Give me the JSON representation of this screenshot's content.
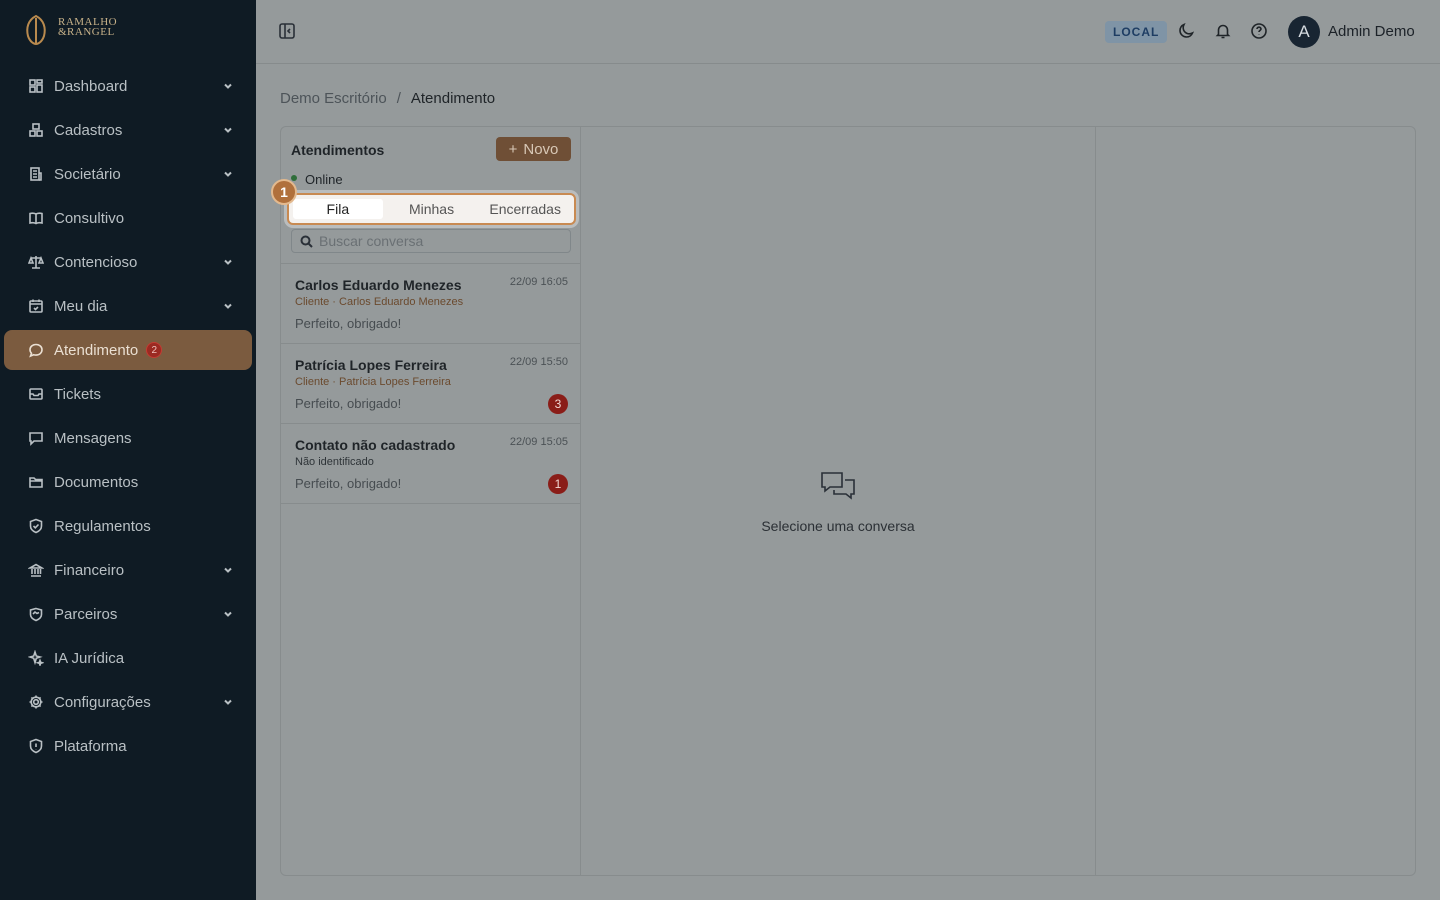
{
  "brand": {
    "line1": "RAMALHO",
    "line2": "&RANGEL"
  },
  "sidebar": {
    "items": [
      {
        "label": "Dashboard",
        "icon": "dashboard-icon",
        "chevron": true
      },
      {
        "label": "Cadastros",
        "icon": "boxes-icon",
        "chevron": true
      },
      {
        "label": "Societário",
        "icon": "building-icon",
        "chevron": true
      },
      {
        "label": "Consultivo",
        "icon": "book-icon",
        "chevron": false
      },
      {
        "label": "Contencioso",
        "icon": "scale-icon",
        "chevron": true
      },
      {
        "label": "Meu dia",
        "icon": "calendar-icon",
        "chevron": true
      },
      {
        "label": "Atendimento",
        "icon": "chat-icon",
        "chevron": false,
        "badge": "2",
        "active": true
      },
      {
        "label": "Tickets",
        "icon": "ticket-icon",
        "chevron": false
      },
      {
        "label": "Mensagens",
        "icon": "message-icon",
        "chevron": false
      },
      {
        "label": "Documentos",
        "icon": "folder-icon",
        "chevron": false
      },
      {
        "label": "Regulamentos",
        "icon": "shield-check-icon",
        "chevron": false
      },
      {
        "label": "Financeiro",
        "icon": "bank-icon",
        "chevron": true
      },
      {
        "label": "Parceiros",
        "icon": "handshake-icon",
        "chevron": true
      },
      {
        "label": "IA Jurídica",
        "icon": "sparkles-icon",
        "chevron": false
      },
      {
        "label": "Configurações",
        "icon": "gear-icon",
        "chevron": true
      },
      {
        "label": "Plataforma",
        "icon": "shield-icon",
        "chevron": false
      }
    ]
  },
  "topbar": {
    "env_badge": "LOCAL",
    "avatar_initial": "A",
    "user_name": "Admin Demo"
  },
  "breadcrumb": {
    "parent": "Demo Escritório",
    "separator": "/",
    "current": "Atendimento"
  },
  "list": {
    "title": "Atendimentos",
    "new_button": "Novo",
    "status": "Online",
    "step_marker": "1",
    "tabs": [
      "Fila",
      "Minhas",
      "Encerradas"
    ],
    "search_placeholder": "Buscar conversa",
    "conversations": [
      {
        "name": "Carlos Eduardo Menezes",
        "time": "22/09 16:05",
        "sub": "Cliente · Carlos Eduardo Menezes",
        "preview": "Perfeito, obrigado!",
        "unread": ""
      },
      {
        "name": "Patrícia Lopes Ferreira",
        "time": "22/09 15:50",
        "sub": "Cliente · Patrícia Lopes Ferreira",
        "preview": "Perfeito, obrigado!",
        "unread": "3"
      },
      {
        "name": "Contato não cadastrado",
        "time": "22/09 15:05",
        "sub": "Não identificado",
        "preview": "Perfeito, obrigado!",
        "unread": "1"
      }
    ]
  },
  "empty_state": {
    "label": "Selecione uma conversa"
  }
}
